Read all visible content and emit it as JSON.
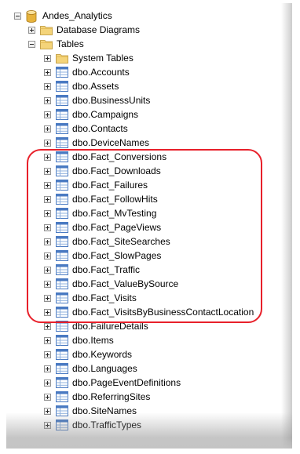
{
  "tree": {
    "root": {
      "label": "Andes_Analytics"
    },
    "database_diagrams": {
      "label": "Database Diagrams"
    },
    "tables": {
      "label": "Tables"
    },
    "system_tables": {
      "label": "System Tables"
    },
    "table_items": [
      "dbo.Accounts",
      "dbo.Assets",
      "dbo.BusinessUnits",
      "dbo.Campaigns",
      "dbo.Contacts",
      "dbo.DeviceNames",
      "dbo.Fact_Conversions",
      "dbo.Fact_Downloads",
      "dbo.Fact_Failures",
      "dbo.Fact_FollowHits",
      "dbo.Fact_MvTesting",
      "dbo.Fact_PageViews",
      "dbo.Fact_SiteSearches",
      "dbo.Fact_SlowPages",
      "dbo.Fact_Traffic",
      "dbo.Fact_ValueBySource",
      "dbo.Fact_Visits",
      "dbo.Fact_VisitsByBusinessContactLocation",
      "dbo.FailureDetails",
      "dbo.Items",
      "dbo.Keywords",
      "dbo.Languages",
      "dbo.PageEventDefinitions",
      "dbo.ReferringSites",
      "dbo.SiteNames",
      "dbo.TrafficTypes"
    ]
  },
  "colors": {
    "highlight": "#e8202a",
    "folder": "#f4d47a",
    "table_icon": "#4a7ac2",
    "database_icon": "#e7b33c"
  },
  "icons": {
    "expand": "plus-box-icon",
    "collapse": "minus-box-icon",
    "database": "database-icon",
    "folder": "folder-icon",
    "table": "table-icon"
  }
}
